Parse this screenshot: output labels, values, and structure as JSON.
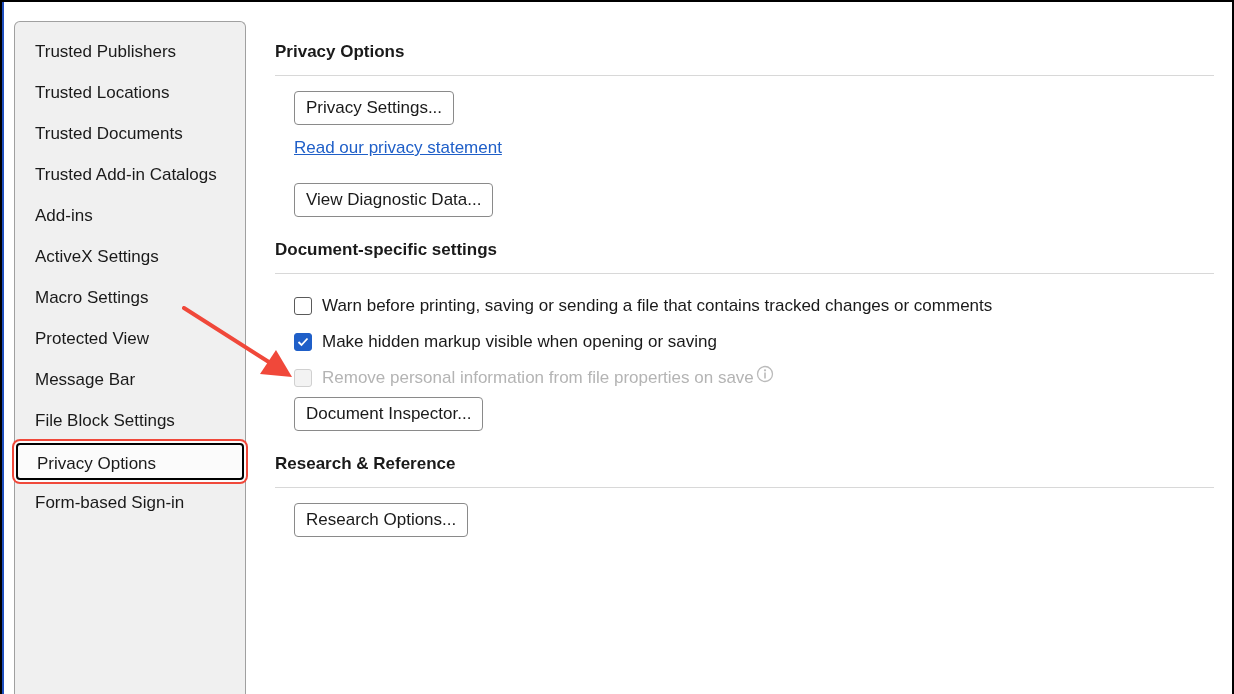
{
  "sidebar": {
    "items": [
      {
        "label": "Trusted Publishers",
        "selected": false
      },
      {
        "label": "Trusted Locations",
        "selected": false
      },
      {
        "label": "Trusted Documents",
        "selected": false
      },
      {
        "label": "Trusted Add-in Catalogs",
        "selected": false
      },
      {
        "label": "Add-ins",
        "selected": false
      },
      {
        "label": "ActiveX Settings",
        "selected": false
      },
      {
        "label": "Macro Settings",
        "selected": false
      },
      {
        "label": "Protected View",
        "selected": false
      },
      {
        "label": "Message Bar",
        "selected": false
      },
      {
        "label": "File Block Settings",
        "selected": false
      },
      {
        "label": "Privacy Options",
        "selected": true
      },
      {
        "label": "Form-based Sign-in",
        "selected": false
      }
    ]
  },
  "sections": [
    {
      "title": "Privacy Options",
      "items": [
        {
          "kind": "button",
          "label": "Privacy Settings..."
        },
        {
          "kind": "link",
          "label": "Read our privacy statement"
        },
        {
          "kind": "button",
          "label": "View Diagnostic Data..."
        }
      ]
    },
    {
      "title": "Document-specific settings",
      "items": [
        {
          "kind": "checkbox",
          "label": "Warn before printing, saving or sending a file that contains tracked changes or comments",
          "checked": false,
          "disabled": false
        },
        {
          "kind": "checkbox",
          "label": "Make hidden markup visible when opening or saving",
          "checked": true,
          "disabled": false
        },
        {
          "kind": "checkbox",
          "label": "Remove personal information from file properties on save",
          "checked": false,
          "disabled": true,
          "info": true
        },
        {
          "kind": "button",
          "label": "Document Inspector..."
        }
      ]
    },
    {
      "title": "Research & Reference",
      "items": [
        {
          "kind": "button",
          "label": "Research Options..."
        }
      ]
    }
  ]
}
